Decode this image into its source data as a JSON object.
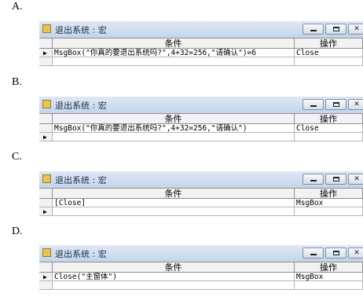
{
  "options": [
    {
      "letter": "A.",
      "window_title": "退出系统 : 宏",
      "columns": {
        "condition": "条件",
        "action": "操作"
      },
      "rows": [
        {
          "indicator": "▶",
          "condition": "MsgBox(\"你真的要退出系统吗?\",4+32=256,\"请确认\")=6",
          "action": "Close"
        },
        {
          "indicator": "",
          "condition": "",
          "action": ""
        }
      ]
    },
    {
      "letter": "B.",
      "window_title": "退出系统 : 宏",
      "columns": {
        "condition": "条件",
        "action": "操作"
      },
      "rows": [
        {
          "indicator": "",
          "condition": "MsgBox(\"你真的要退出系统吗?\",4+32=256,\"请确认\")",
          "action": "Close"
        },
        {
          "indicator": "▶",
          "condition": "",
          "action": ""
        }
      ]
    },
    {
      "letter": "C.",
      "window_title": "退出系统 : 宏",
      "columns": {
        "condition": "条件",
        "action": "操作"
      },
      "rows": [
        {
          "indicator": "",
          "condition": "[Close]",
          "action": "MsgBox"
        },
        {
          "indicator": "▶",
          "condition": "",
          "action": ""
        }
      ]
    },
    {
      "letter": "D.",
      "window_title": "退出系统 : 宏",
      "columns": {
        "condition": "条件",
        "action": "操作"
      },
      "rows": [
        {
          "indicator": "▶",
          "condition": "Close(\"主窗体\")",
          "action": "MsgBox"
        },
        {
          "indicator": "",
          "condition": "",
          "action": ""
        }
      ]
    }
  ],
  "icons": {
    "window": "macro-icon",
    "minimize": "minimize-icon",
    "maximize": "maximize-icon",
    "close": "close-icon",
    "record": "record-indicator-icon"
  }
}
